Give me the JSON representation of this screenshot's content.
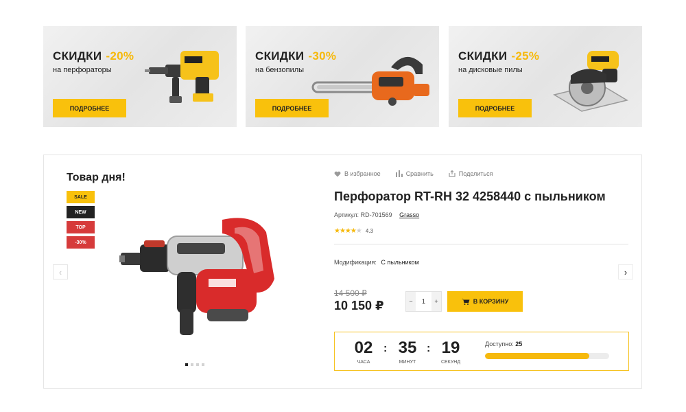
{
  "banners": [
    {
      "title": "СКИДКИ",
      "discount": "-20%",
      "subtitle": "на перфораторы",
      "button": "ПОДРОБНЕЕ"
    },
    {
      "title": "СКИДКИ",
      "discount": "-30%",
      "subtitle": "на бензопилы",
      "button": "ПОДРОБНЕЕ"
    },
    {
      "title": "СКИДКИ",
      "discount": "-25%",
      "subtitle": "на дисковые пилы",
      "button": "ПОДРОБНЕЕ"
    }
  ],
  "deal": {
    "heading": "Товар дня!",
    "badges": [
      "SALE",
      "NEW",
      "TOP",
      "-30%"
    ],
    "actions": {
      "favorite": "В избранное",
      "compare": "Сравнить",
      "share": "Поделиться"
    },
    "product": {
      "title": "Перфоратор RT-RH 32 4258440 с пыльником",
      "sku_label": "Артикул:",
      "sku": "RD-701569",
      "brand": "Grasso",
      "rating": 4.3,
      "rating_text": "4.3",
      "modification_label": "Модификация:",
      "modification": "С пыльником",
      "old_price": "14 500 ₽",
      "price": "10 150 ₽",
      "quantity": "1",
      "cart_button": "В КОРЗИНУ"
    },
    "slider": {
      "total": 4,
      "active": 1
    },
    "timer": {
      "hours": "02",
      "minutes": "35",
      "seconds": "19",
      "hours_label": "ЧАСА",
      "minutes_label": "МИНУТ",
      "seconds_label": "СЕКУНД"
    },
    "availability": {
      "label": "Доступно:",
      "value": "25",
      "fill_fraction": 0.84
    }
  },
  "colors": {
    "accent": "#f9c10c",
    "badge_red": "#d63b3b",
    "dark": "#222222"
  }
}
